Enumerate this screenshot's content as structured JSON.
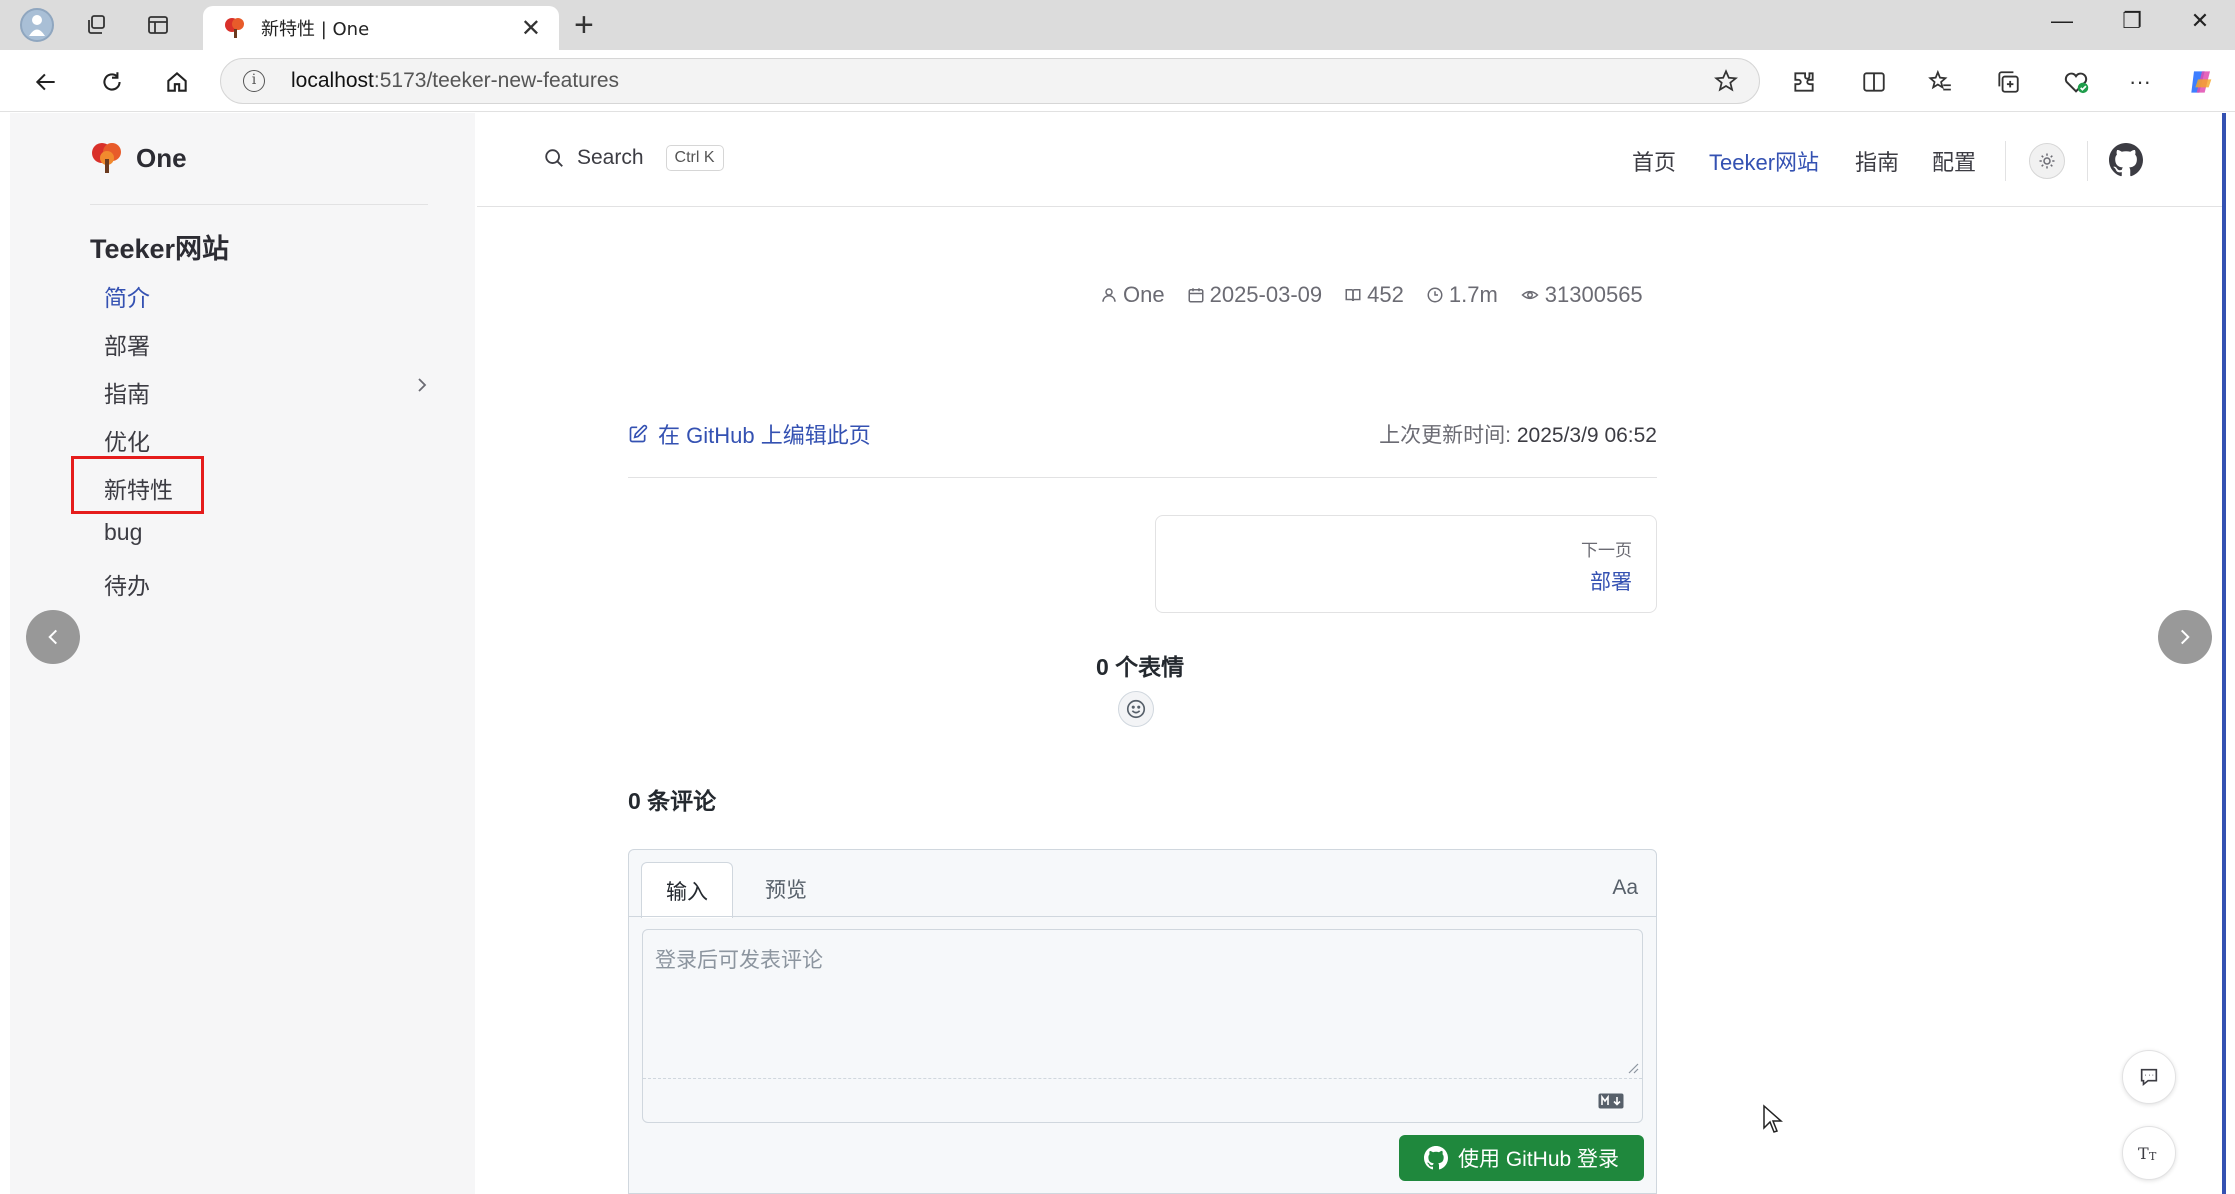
{
  "browser": {
    "tab_title": "新特性 | One",
    "url_host": "localhost",
    "url_path": ":5173/teeker-new-features",
    "tab_close_symbol": "✕",
    "new_tab_symbol": "+",
    "window_controls": {
      "minimize": "—",
      "restore": "❐",
      "close": "✕"
    },
    "more_menu": "···"
  },
  "site": {
    "logo_text": "One",
    "search_label": "Search",
    "search_shortcut": "Ctrl K",
    "nav": [
      {
        "label": "首页",
        "active": false
      },
      {
        "label": "Teeker网站",
        "active": true
      },
      {
        "label": "指南",
        "active": false
      },
      {
        "label": "配置",
        "active": false
      }
    ]
  },
  "sidebar": {
    "section_title": "Teeker网站",
    "items": [
      {
        "label": "简介",
        "active": true
      },
      {
        "label": "部署",
        "active": false
      },
      {
        "label": "指南",
        "active": false,
        "has_children": true
      },
      {
        "label": "优化",
        "active": false
      },
      {
        "label": "新特性",
        "active": false,
        "highlighted": true
      },
      {
        "label": "bug",
        "active": false
      },
      {
        "label": "待办",
        "active": false
      }
    ]
  },
  "article": {
    "meta": {
      "author": "One",
      "date": "2025-03-09",
      "words": "452",
      "reading_time": "1.7m",
      "views": "31300565"
    },
    "edit_link": "在 GitHub 上编辑此页",
    "updated_label": "上次更新时间:",
    "updated_value": "2025/3/9 06:52",
    "next_label": "下一页",
    "next_title": "部署"
  },
  "comments": {
    "reactions_title": "0 个表情",
    "count_title": "0 条评论",
    "tab_write": "输入",
    "tab_preview": "预览",
    "aa_label": "Aa",
    "placeholder": "登录后可发表评论",
    "login_button": "使用 GitHub 登录"
  },
  "colors": {
    "brand": "#3451b2",
    "highlight_box": "#e51c1c",
    "login_button": "#1f883d"
  }
}
